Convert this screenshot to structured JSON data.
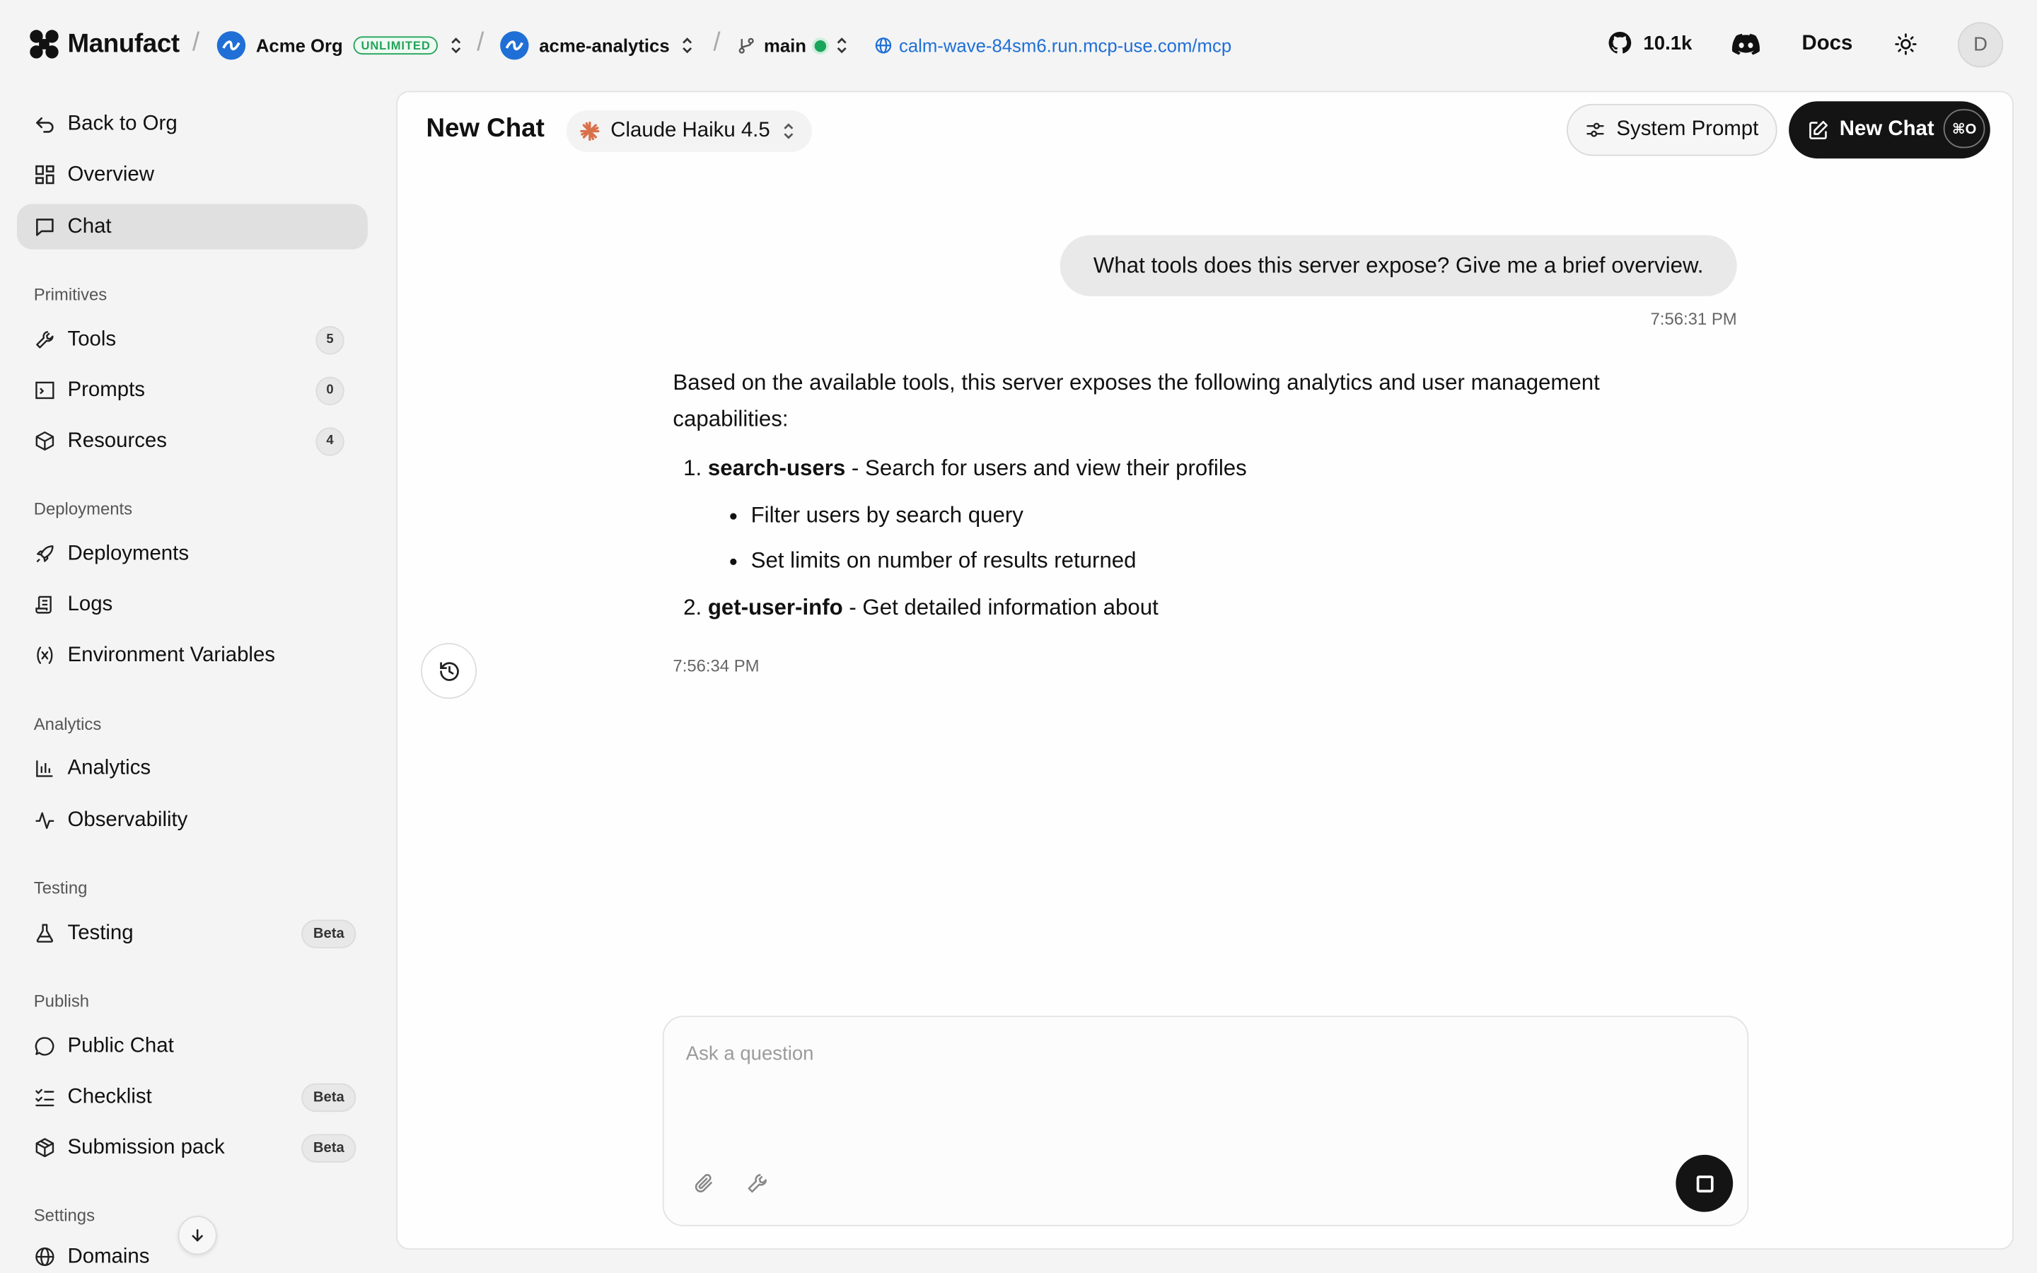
{
  "topbar": {
    "brand": "Manufact",
    "org_name": "Acme Org",
    "org_badge": "UNLIMITED",
    "project": "acme-analytics",
    "branch": "main",
    "url": "calm-wave-84sm6.run.mcp-use.com/mcp",
    "github_stars": "10.1k",
    "docs": "Docs",
    "user_initial": "D",
    "separator": "/"
  },
  "sidebar": {
    "back": "Back to Org",
    "overview": "Overview",
    "chat": "Chat",
    "sections": {
      "primitives": "Primitives",
      "deployments": "Deployments",
      "analytics": "Analytics",
      "testing": "Testing",
      "publish": "Publish",
      "settings": "Settings"
    },
    "items": {
      "tools": "Tools",
      "tools_count": "5",
      "prompts": "Prompts",
      "prompts_count": "0",
      "resources": "Resources",
      "resources_count": "4",
      "deployments": "Deployments",
      "logs": "Logs",
      "env": "Environment Variables",
      "analytics": "Analytics",
      "observability": "Observability",
      "testing": "Testing",
      "public_chat": "Public Chat",
      "checklist": "Checklist",
      "submission": "Submission pack",
      "domains": "Domains",
      "beta": "Beta"
    }
  },
  "chat": {
    "title": "New Chat",
    "model": "Claude Haiku 4.5",
    "system_prompt": "System Prompt",
    "new_chat": "New Chat",
    "shortcut": "⌘O",
    "user_message": "What tools does this server expose? Give me a brief overview.",
    "user_time": "7:56:31 PM",
    "assistant_intro": "Based on the available tools, this server exposes the following analytics and user management capabilities:",
    "tool1_num": "1.",
    "tool1_name": "search-users",
    "tool1_desc": " - Search for users and view their profiles",
    "tool1_bullets": [
      "Filter users by search query",
      "Set limits on number of results returned"
    ],
    "tool2_num": "2.",
    "tool2_name": "get-user-info",
    "tool2_desc": " - Get detailed information about",
    "assistant_time": "7:56:34 PM",
    "placeholder": "Ask a question"
  },
  "colors": {
    "accent": "#1f6fd6",
    "status_green": "#19a55b",
    "dark_button": "#141414"
  }
}
